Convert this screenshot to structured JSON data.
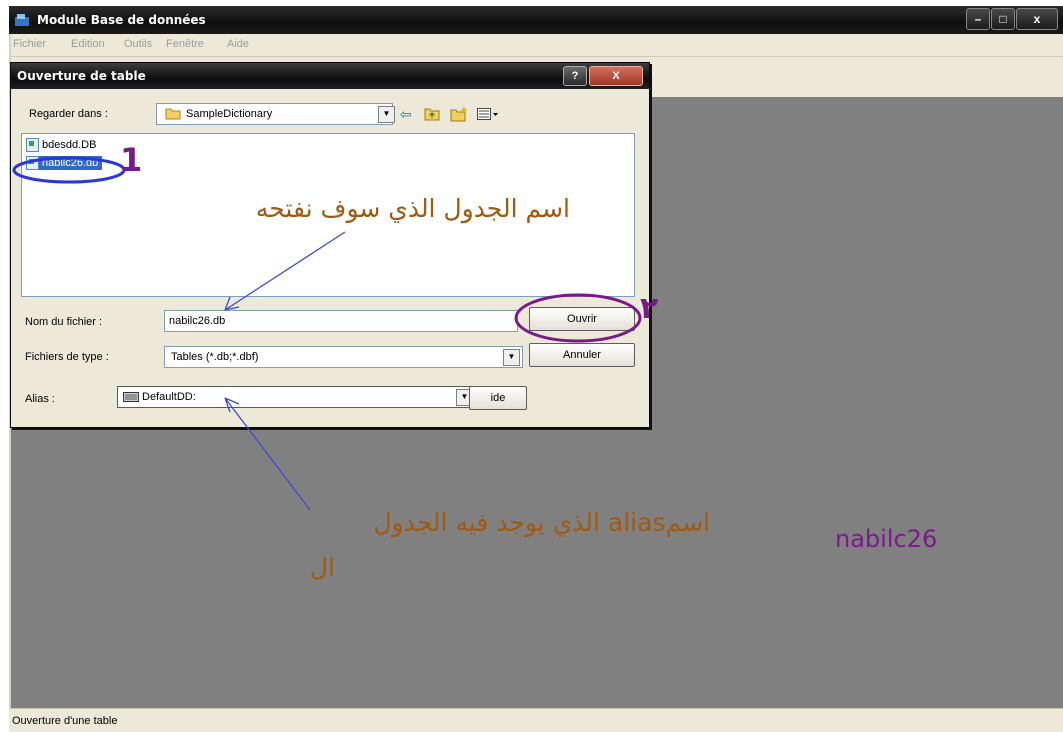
{
  "window": {
    "title": "Module Base de données",
    "buttons": {
      "minimize": "–",
      "maximize": "□",
      "close": "x"
    }
  },
  "menu": [
    "Fichier",
    "Edition",
    "Outils",
    "Fenêtre",
    "Aide"
  ],
  "status": "Ouverture d'une table",
  "dialog": {
    "title": "Ouverture de table",
    "help_button": "?",
    "close_button": "X",
    "look_in_label": "Regarder dans :",
    "look_in_value": "SampleDictionary",
    "files": [
      "bdesdd.DB",
      "nabilc26.db"
    ],
    "filename_label": "Nom du fichier :",
    "filename_value": "nabilc26.db",
    "filetype_label": "Fichiers de type :",
    "filetype_value": "Tables (*.db;*.dbf)",
    "alias_label": "Alias :",
    "alias_value": "DefaultDD:",
    "open_button": "Ouvrir",
    "cancel_button": "Annuler",
    "help_text_button": "ide"
  },
  "annotations": {
    "marker_1": "1",
    "marker_2": "٢",
    "table_name_note": "اسم الجدول الذي سوف نفتحه",
    "alias_note_line1": "اسمalias الذي يوجد فيه الجدول",
    "alias_note_line2": "ال",
    "signature": "nabilc26"
  },
  "colors": {
    "workspace": "#808080",
    "dialog_bg": "#ece9d8",
    "annotation_brown": "#a05a10",
    "annotation_purple": "#7a1a8a",
    "annotation_blue": "#2a36d8"
  }
}
